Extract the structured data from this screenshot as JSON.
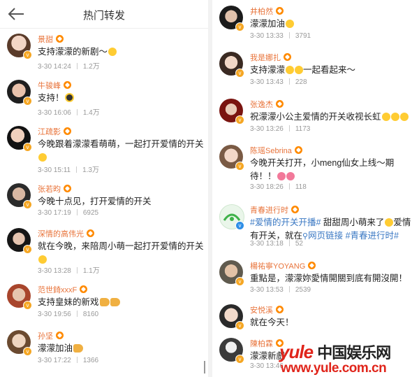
{
  "header": {
    "title": "热门转发"
  },
  "left_items": [
    {
      "name": "景甜",
      "text": "支持濛濛的新剧～",
      "emoji": [
        "smile"
      ],
      "date": "3-30 14:24",
      "count": "1.2万"
    },
    {
      "name": "牛骏峰",
      "text": "支持！",
      "emoji": [
        "cool"
      ],
      "date": "3-30 16:06",
      "count": "1.4万"
    },
    {
      "name": "江疏影",
      "text": "今晚跟着濛濛看萌萌，一起打开爱情的开关",
      "emoji": [
        "smile"
      ],
      "date": "3-30 15:11",
      "count": "1.3万"
    },
    {
      "name": "张若昀",
      "text": "今晚十点见，打开爱情的开关",
      "emoji": [],
      "date": "3-30 17:19",
      "count": "6925"
    },
    {
      "name": "深情的高伟光",
      "text": "就在今晚，来陪周小萌一起打开爱情的开关",
      "emoji": [
        "smile"
      ],
      "date": "3-30 13:28",
      "count": "1.1万"
    },
    {
      "name": "范世錡xxxF",
      "text": "支持皇妹的新戏",
      "emoji": [
        "muscle",
        "muscle"
      ],
      "date": "3-30 19:56",
      "count": "8160"
    },
    {
      "name": "孙坚",
      "text": "濛濛加油",
      "emoji": [
        "muscle"
      ],
      "date": "3-30 17:22",
      "count": "1366"
    }
  ],
  "right_items": [
    {
      "name": "井柏然",
      "text": "濛濛加油",
      "emoji": [
        "smile"
      ],
      "date": "3-30 13:33",
      "count": "3791"
    },
    {
      "name": "我是娜扎",
      "text": "支持濛濛",
      "emoji": [
        "smile",
        "smile"
      ],
      "text2": "一起看起来～",
      "date": "3-30 13:43",
      "count": "228"
    },
    {
      "name": "张逸杰",
      "text": "祝濛濛小公主爱情的开关收视长虹",
      "emoji": [
        "smile",
        "smile",
        "smile"
      ],
      "date": "3-30 13:26",
      "count": "1173"
    },
    {
      "name": "陈瑶Sebrina",
      "text": "今晚开关打开，小meng仙女上线～期待！！",
      "emoji": [
        "pink",
        "pink"
      ],
      "date": "3-30 18:26",
      "count": "118"
    },
    {
      "name": "青春进行时",
      "hl1": "#爱情的开关开播#",
      "text": " 甜甜周小萌来了",
      "emoji": [
        "smile"
      ],
      "text2": "爱情有开关，就在",
      "hl2": "网页链接",
      "hl3": " #青春进行时#",
      "date": "3-30 13:18",
      "count": "52"
    },
    {
      "name": "楊祐寧YOYANG",
      "text": "重點是，濛濛妳愛情開關到底有開沒開！",
      "emoji": [],
      "date": "3-30 13:53",
      "count": "2539"
    },
    {
      "name": "安悦溪",
      "text": "就在今天！",
      "emoji": [],
      "date": "3-30 18:12",
      "count": ""
    },
    {
      "name": "陳柏霖",
      "text": "濛濛新戲",
      "emoji": [],
      "date": "3-30 13:46",
      "count": ""
    }
  ],
  "watermark": {
    "brand": "yule",
    "cn": "中国娱乐网",
    "url": "www.yule.com.cn"
  },
  "colors": {
    "name": "#e8733a",
    "link": "#3a78c3",
    "badge": "#f5a623",
    "watermark": "#e0251b"
  }
}
